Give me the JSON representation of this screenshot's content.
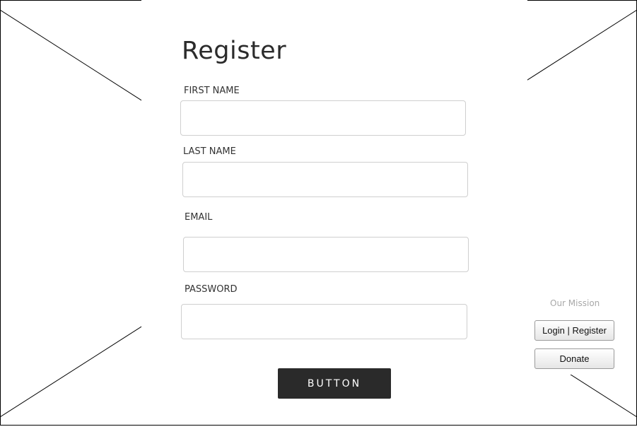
{
  "form": {
    "title": "Register",
    "fields": [
      {
        "label": "FIRST NAME",
        "value": "",
        "placeholder": ""
      },
      {
        "label": "LAST NAME",
        "value": "",
        "placeholder": ""
      },
      {
        "label": "EMAIL",
        "value": "",
        "placeholder": ""
      },
      {
        "label": "PASSWORD",
        "value": "",
        "placeholder": ""
      }
    ],
    "submit_label": "BUTTON"
  },
  "side_panel": {
    "mission_link": "Our Mission",
    "login_register_label": "Login | Register",
    "donate_label": "Donate"
  }
}
